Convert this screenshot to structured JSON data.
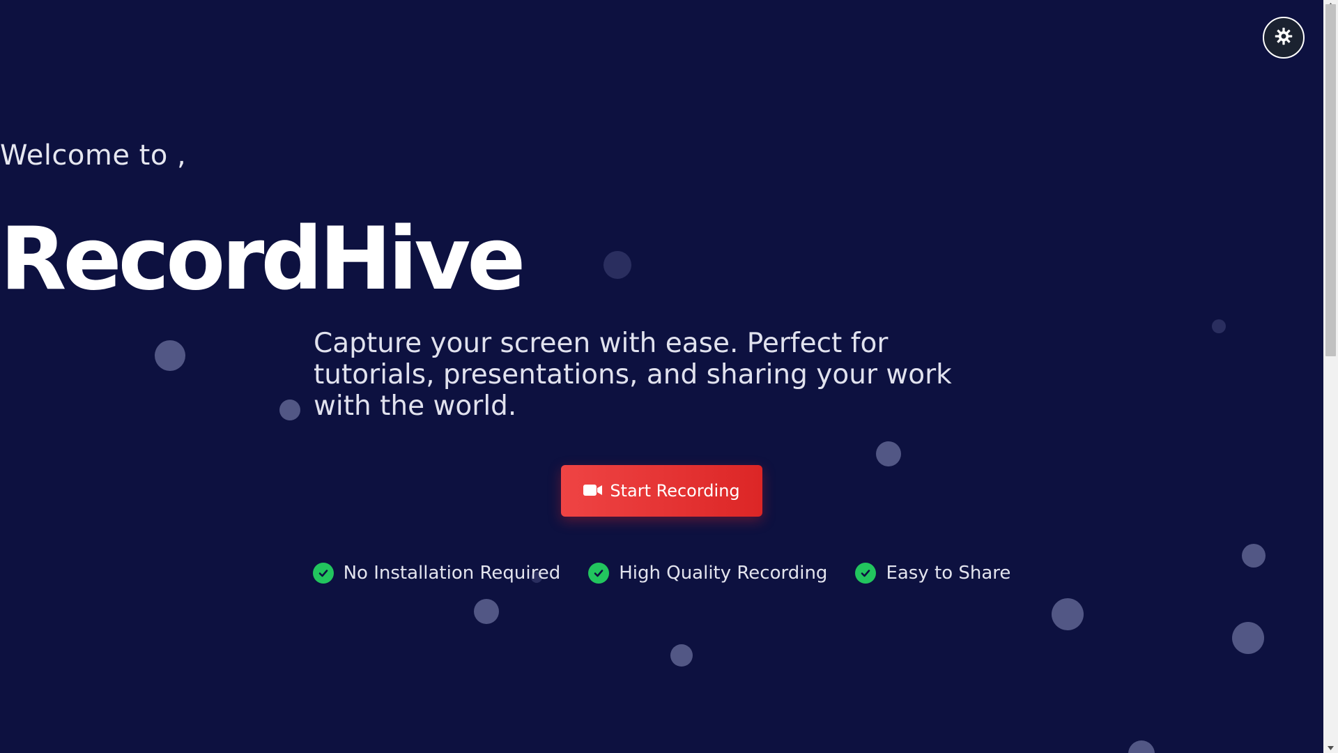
{
  "theme_toggle": {
    "icon": "gear-icon"
  },
  "hero": {
    "welcome": "Welcome to ,",
    "brand": "RecordHive",
    "tagline": "Capture your screen with ease. Perfect for tutorials, presentations, and sharing your work with the world."
  },
  "cta": {
    "icon": "video-camera-icon",
    "label": "Start Recording"
  },
  "features": [
    {
      "icon": "check-circle-icon",
      "label": "No Installation Required"
    },
    {
      "icon": "check-circle-icon",
      "label": "High Quality Recording"
    },
    {
      "icon": "check-circle-icon",
      "label": "Easy to Share"
    }
  ],
  "colors": {
    "background": "#0d1140",
    "accent": "#ef4444",
    "check": "#22c55e",
    "bubble": "#8c91be"
  }
}
